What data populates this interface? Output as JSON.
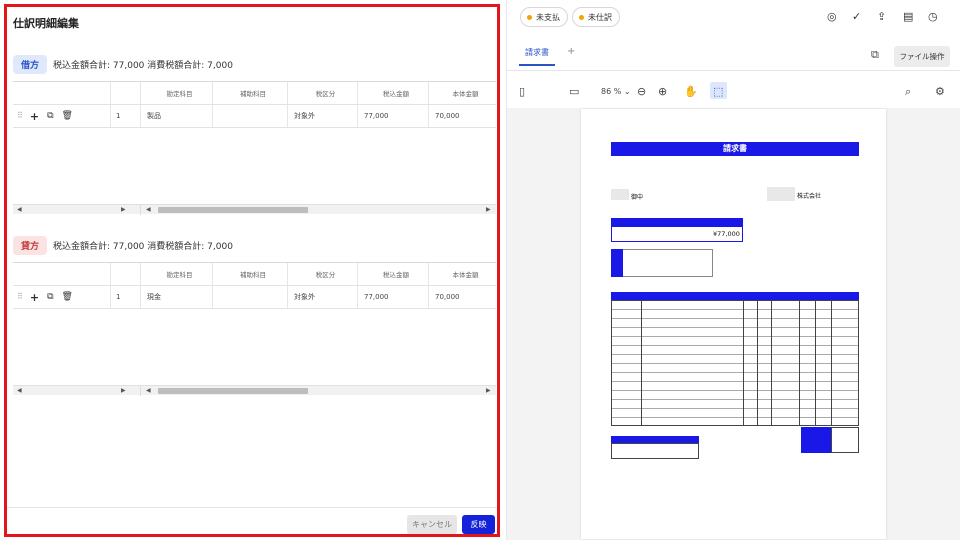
{
  "left": {
    "title": "仕訳明細編集",
    "debit": {
      "badge": "借方",
      "summary": "税込金額合計: 77,000  消費税額合計: 7,000",
      "columns": [
        "勘定科目",
        "補助科目",
        "税区分",
        "税込金額",
        "本体金額"
      ],
      "rows": [
        {
          "no": "1",
          "account": "製品",
          "sub": "",
          "tax": "対象外",
          "incl": "77,000",
          "base": "70,000"
        }
      ]
    },
    "credit": {
      "badge": "貸方",
      "summary": "税込金額合計: 77,000  消費税額合計: 7,000",
      "columns": [
        "勘定科目",
        "補助科目",
        "税区分",
        "税込金額",
        "本体金額"
      ],
      "rows": [
        {
          "no": "1",
          "account": "現金",
          "sub": "",
          "tax": "対象外",
          "incl": "77,000",
          "base": "70,000"
        }
      ]
    },
    "cancel": "キャンセル",
    "apply": "反映"
  },
  "right": {
    "chip1": "未支払",
    "chip2": "未仕訳",
    "tab": "請求書",
    "tab_add": "+",
    "file_action": "ファイル操作",
    "zoom": "86 %",
    "invoice": {
      "title": "請求書",
      "customer": "御中",
      "company": "株式会社",
      "amount_label": "ご請求金額(税込)",
      "amount": "¥77,000"
    }
  },
  "colors": {
    "accent": "#1423d9",
    "highlight": "#e3141b",
    "debit_bg": "#dfe9fb",
    "credit_bg": "#fbe3e3",
    "status_dot": "#f0a500"
  }
}
